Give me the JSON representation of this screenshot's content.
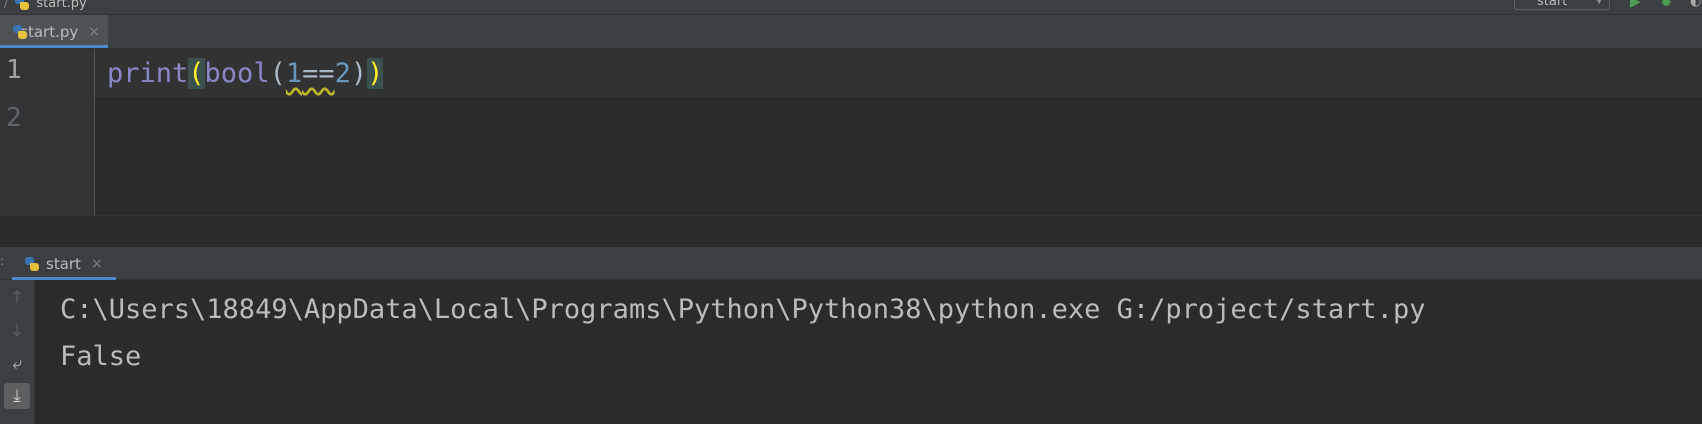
{
  "navbar": {
    "breadcrumb_file": "start.py",
    "run_config": "start"
  },
  "editor_tab": {
    "label": "start.py",
    "close": "×"
  },
  "editor": {
    "line_numbers": [
      "1",
      "2"
    ],
    "code": {
      "func": "print",
      "open1": "(",
      "inner_func": "bool",
      "open2": "(",
      "num1": "1",
      "op": "==",
      "num2": "2",
      "close2": ")",
      "close1": ")"
    }
  },
  "run_tab": {
    "label": "start",
    "close": "×"
  },
  "console": {
    "command": "C:\\Users\\18849\\AppData\\Local\\Programs\\Python\\Python38\\python.exe G:/project/start.py",
    "output": "False"
  },
  "run_toolbar": {
    "up_icon": "↑",
    "down_icon": "↓",
    "wrap_icon": "⤶",
    "scroll_end_icon": "⤓"
  },
  "colors": {
    "background": "#2b2b2b",
    "builtin": "#8888c6",
    "number": "#6897bb",
    "brace_match": "#ffef28",
    "tab_underline": "#4a88c7"
  }
}
